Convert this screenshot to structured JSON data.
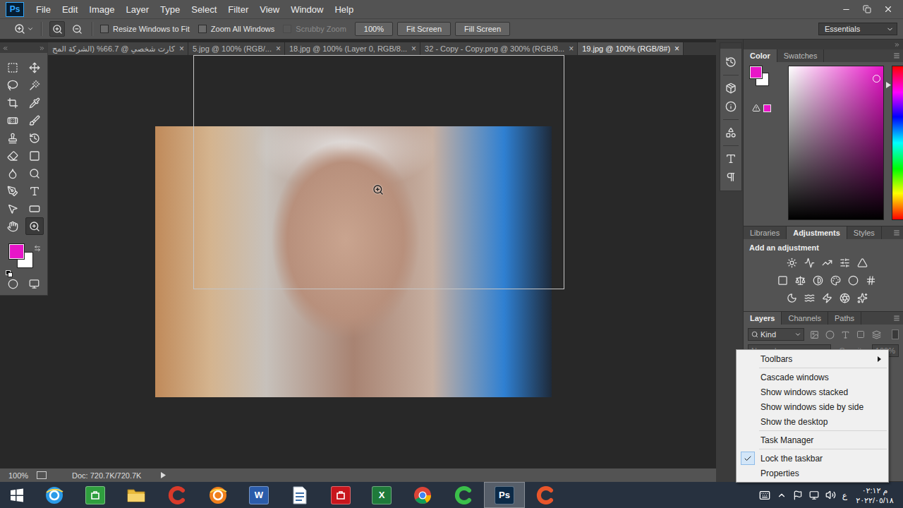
{
  "app": {
    "logo": "Ps"
  },
  "menu_bar": [
    "File",
    "Edit",
    "Image",
    "Layer",
    "Type",
    "Select",
    "Filter",
    "View",
    "Window",
    "Help"
  ],
  "options_bar": {
    "zoom_modes": [
      {
        "selected": true
      },
      {
        "selected": false
      }
    ],
    "checkboxes": [
      {
        "label": "Resize Windows to Fit",
        "checked": false,
        "disabled": false
      },
      {
        "label": "Zoom All Windows",
        "checked": false,
        "disabled": false
      },
      {
        "label": "Scrubby Zoom",
        "checked": false,
        "disabled": true
      }
    ],
    "buttons": [
      "100%",
      "Fit Screen",
      "Fill Screen"
    ],
    "workspace": "Essentials"
  },
  "document_tabs": {
    "close": "×",
    "tabs": [
      {
        "label": "كارت شخصي @ 66.7% (الشركة المح",
        "selected": false
      },
      {
        "label": "5.jpg @ 100% (RGB/...",
        "selected": false
      },
      {
        "label": "18.jpg @ 100% (Layer 0, RGB/8...",
        "selected": false
      },
      {
        "label": "32 - Copy - Copy.png @ 300% (RGB/8...",
        "selected": false
      },
      {
        "label": "19.jpg @ 100% (RGB/8#)",
        "selected": true
      }
    ]
  },
  "tools": {
    "items": [
      {
        "selected": false
      },
      {
        "selected": false
      },
      {
        "selected": false
      },
      {
        "selected": false
      },
      {
        "selected": false
      },
      {
        "selected": false
      },
      {
        "selected": false
      },
      {
        "selected": false
      },
      {
        "selected": false
      },
      {
        "selected": false
      },
      {
        "selected": false
      },
      {
        "selected": false
      },
      {
        "selected": false
      },
      {
        "selected": false
      },
      {
        "selected": false
      },
      {
        "selected": false
      },
      {
        "selected": false
      },
      {
        "selected": false
      },
      {
        "selected": false
      },
      {
        "selected": true
      }
    ],
    "foreground_color": "#e815c8",
    "background_color": "#ffffff"
  },
  "status_bar": {
    "zoom": "100%",
    "doc": "Doc: 720.7K/720.7K"
  },
  "color_panel": {
    "tabs": [
      {
        "label": "Color",
        "selected": true
      },
      {
        "label": "Swatches",
        "selected": false
      }
    ]
  },
  "adjustments_panel": {
    "tabs": [
      {
        "label": "Libraries",
        "selected": false
      },
      {
        "label": "Adjustments",
        "selected": true
      },
      {
        "label": "Styles",
        "selected": false
      }
    ],
    "title": "Add an adjustment"
  },
  "layers_panel": {
    "tabs": [
      {
        "label": "Layers",
        "selected": true
      },
      {
        "label": "Channels",
        "selected": false
      },
      {
        "label": "Paths",
        "selected": false
      }
    ],
    "filter": "Kind",
    "blend_mode": "Normal",
    "opacity_label": "Opacity:",
    "opacity": "100%",
    "disabled": true
  },
  "context_menu": {
    "groups": [
      [
        {
          "label": "Toolbars",
          "submenu": true,
          "checked": false
        }
      ],
      [
        {
          "label": "Cascade windows",
          "submenu": false,
          "checked": false
        },
        {
          "label": "Show windows stacked",
          "submenu": false,
          "checked": false
        },
        {
          "label": "Show windows side by side",
          "submenu": false,
          "checked": false
        },
        {
          "label": "Show the desktop",
          "submenu": false,
          "checked": false
        }
      ],
      [
        {
          "label": "Task Manager",
          "submenu": false,
          "checked": false
        }
      ],
      [
        {
          "label": "Lock the taskbar",
          "submenu": false,
          "checked": true
        },
        {
          "label": "Properties",
          "submenu": false,
          "checked": false
        }
      ]
    ]
  },
  "taskbar": {
    "apps": [
      {
        "kind": "round",
        "color": "#2b9be8",
        "active": false
      },
      {
        "kind": "tile",
        "color": "#2f9e3e",
        "active": false
      },
      {
        "kind": "folder",
        "color": "#e8b93a",
        "active": false
      },
      {
        "kind": "swirl",
        "color": "#d83a2a",
        "active": false
      },
      {
        "kind": "round",
        "color": "#f0801c",
        "active": false
      },
      {
        "kind": "tile",
        "color": "#2b5caa",
        "active": false,
        "glyph": "W"
      },
      {
        "kind": "page",
        "color": "#3c6ea8",
        "active": false
      },
      {
        "kind": "tile",
        "color": "#c8161d",
        "active": false
      },
      {
        "kind": "tile",
        "color": "#1f7a3a",
        "active": false,
        "glyph": "X"
      },
      {
        "kind": "chrome",
        "color": "#4285f4",
        "active": false
      },
      {
        "kind": "swirl",
        "color": "#3bbf4a",
        "active": false
      },
      {
        "kind": "tile",
        "color": "#0c2a47",
        "active": true,
        "glyph": "Ps"
      },
      {
        "kind": "swirl",
        "color": "#e8552a",
        "active": false
      }
    ],
    "tray": {
      "language": "ع",
      "time": "م ٠٢:١٢",
      "date": "٢٠٢٢/٠٥/١٨"
    }
  }
}
